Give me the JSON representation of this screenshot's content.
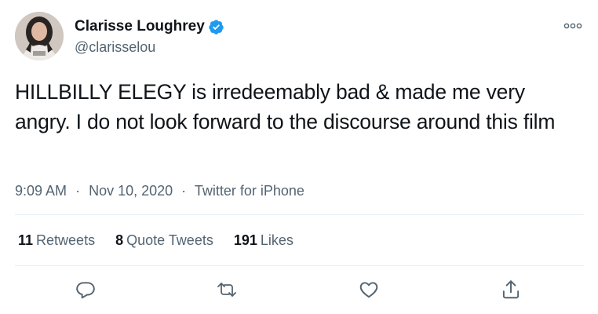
{
  "author": {
    "name": "Clarisse Loughrey",
    "handle": "@clarisselou",
    "verified": true
  },
  "tweet": {
    "text": "HILLBILLY ELEGY is irredeemably bad & made me very angry. I do not look forward to the discourse around this film",
    "time": "9:09 AM",
    "date": "Nov 10, 2020",
    "source": "Twitter for iPhone",
    "separator": "·"
  },
  "stats": {
    "retweets_count": "11",
    "retweets_label": "Retweets",
    "quotes_count": "8",
    "quotes_label": "Quote Tweets",
    "likes_count": "191",
    "likes_label": "Likes"
  },
  "actions": [
    "reply-icon",
    "retweet-icon",
    "like-icon",
    "share-icon"
  ],
  "colors": {
    "verified": "#1d9bf0",
    "secondary_text": "#536471",
    "primary_text": "#0f1419",
    "divider": "#e6ecf0"
  }
}
